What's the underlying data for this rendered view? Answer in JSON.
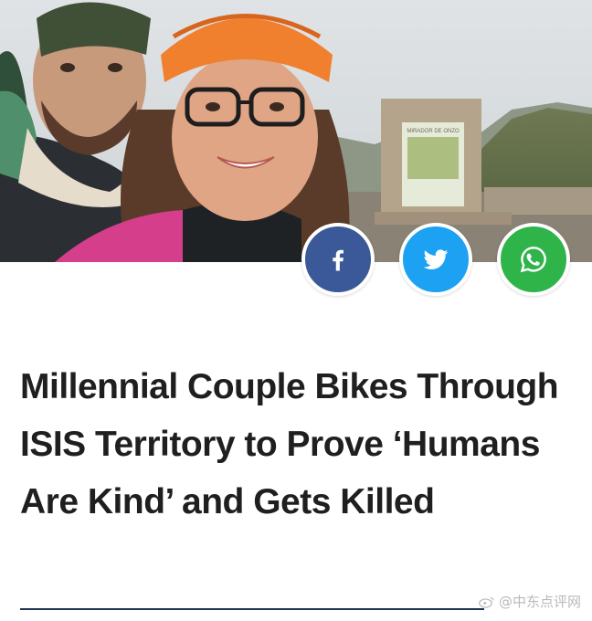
{
  "hero": {
    "image_name": "couple-selfie-photo",
    "sign_text": "MIRADOR DE ONZO"
  },
  "share": {
    "facebook": {
      "icon": "facebook-icon",
      "color": "#3b5998"
    },
    "twitter": {
      "icon": "twitter-icon",
      "color": "#1da1f2"
    },
    "whatsapp": {
      "icon": "whatsapp-icon",
      "color": "#2fb44a"
    }
  },
  "article": {
    "headline": "Millennial Couple Bikes Through ISIS Territory to Prove ‘Humans Are Kind’ and Gets Killed"
  },
  "watermark": {
    "text": "@中东点评网"
  }
}
